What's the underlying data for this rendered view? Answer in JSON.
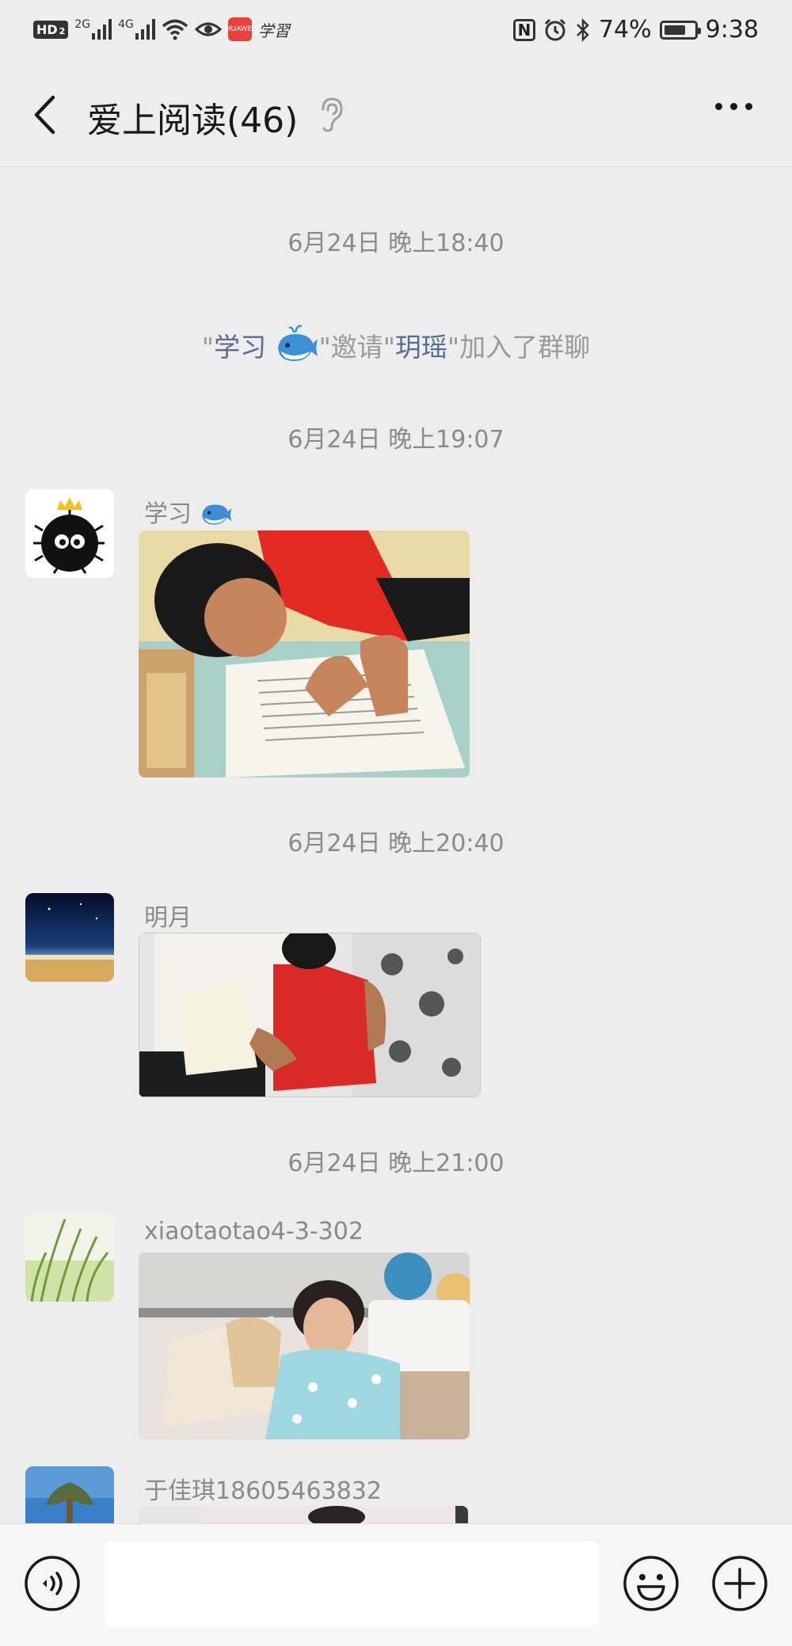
{
  "status_bar": {
    "hd": "HD",
    "hd_sub": "2",
    "net1": "2G",
    "net2": "4G",
    "app_badge": "HUAWEI",
    "app_label": "学習",
    "nfc": "N",
    "battery": "74%",
    "battery_level": 0.74,
    "time": "9:38"
  },
  "header": {
    "title": "爱上阅读(46)"
  },
  "chat": {
    "timestamps": [
      "6月24日 晚上18:40",
      "6月24日 晚上19:07",
      "6月24日 晚上20:40",
      "6月24日 晚上21:00"
    ],
    "system_message": {
      "quote_open": "\"",
      "inviter": "学习",
      "mid": "\"邀请\"",
      "invitee": "玥瑶",
      "tail": "\"加入了群聊"
    },
    "messages": [
      {
        "sender": "学习",
        "type": "image"
      },
      {
        "sender": "明月",
        "type": "image"
      },
      {
        "sender": "xiaotaotao4-3-302",
        "type": "image"
      },
      {
        "sender": "于佳琪18605463832",
        "type": "image"
      }
    ]
  },
  "input_bar": {
    "placeholder": ""
  },
  "icons": {
    "back": "chevron-left-icon",
    "ear": "ear-icon",
    "more": "more-icon",
    "voice": "voice-icon",
    "emoji": "emoji-icon",
    "plus": "plus-icon",
    "whale": "whale-emoji-icon"
  },
  "colors": {
    "background": "#ededed",
    "link": "#576b95",
    "muted": "#8a8a8a"
  }
}
